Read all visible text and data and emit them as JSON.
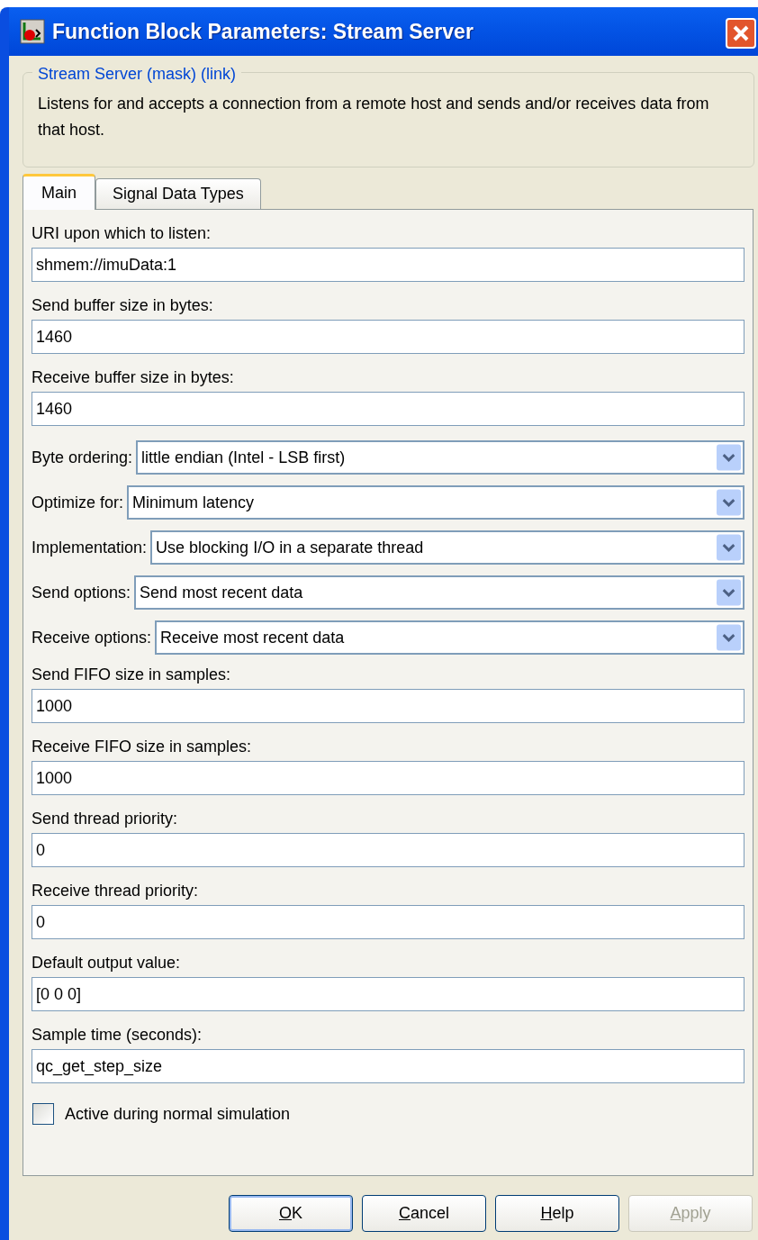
{
  "window": {
    "title": "Function Block Parameters: Stream Server"
  },
  "group": {
    "title": "Stream Server (mask) (link)",
    "description": "Listens for and accepts a connection from a remote host and sends and/or receives data from that host."
  },
  "tabs": [
    {
      "label": "Main",
      "selected": true
    },
    {
      "label": "Signal Data Types",
      "selected": false
    }
  ],
  "parameters": [
    {
      "kind": "text",
      "label": "URI upon which to listen:",
      "value": "shmem://imuData:1"
    },
    {
      "kind": "text",
      "label": "Send buffer size in bytes:",
      "value": "1460"
    },
    {
      "kind": "text",
      "label": "Receive buffer size in bytes:",
      "value": "1460"
    },
    {
      "kind": "select",
      "label": "Byte ordering:",
      "value": "little endian (Intel - LSB first)"
    },
    {
      "kind": "select",
      "label": "Optimize for:",
      "value": "Minimum latency"
    },
    {
      "kind": "select",
      "label": "Implementation:",
      "value": "Use blocking I/O in a separate thread"
    },
    {
      "kind": "select",
      "label": "Send options:",
      "value": "Send most recent data"
    },
    {
      "kind": "select",
      "label": "Receive options:",
      "value": "Receive most recent data"
    },
    {
      "kind": "text",
      "label": "Send FIFO size in samples:",
      "value": "1000"
    },
    {
      "kind": "text",
      "label": "Receive FIFO size in samples:",
      "value": "1000"
    },
    {
      "kind": "text",
      "label": "Send thread priority:",
      "value": "0"
    },
    {
      "kind": "text",
      "label": "Receive thread priority:",
      "value": "0"
    },
    {
      "kind": "text",
      "label": "Default output value:",
      "value": "[0 0 0]"
    },
    {
      "kind": "text",
      "label": "Sample time (seconds):",
      "value": "qc_get_step_size"
    },
    {
      "kind": "checkbox",
      "label": "Active during normal simulation",
      "checked": false
    }
  ],
  "buttons": [
    {
      "access_key": "O",
      "rest": "K",
      "default": true,
      "disabled": false
    },
    {
      "access_key": "C",
      "rest": "ancel",
      "default": false,
      "disabled": false
    },
    {
      "access_key": "H",
      "rest": "elp",
      "default": false,
      "disabled": false
    },
    {
      "access_key": "A",
      "rest": "pply",
      "default": false,
      "disabled": true
    }
  ]
}
